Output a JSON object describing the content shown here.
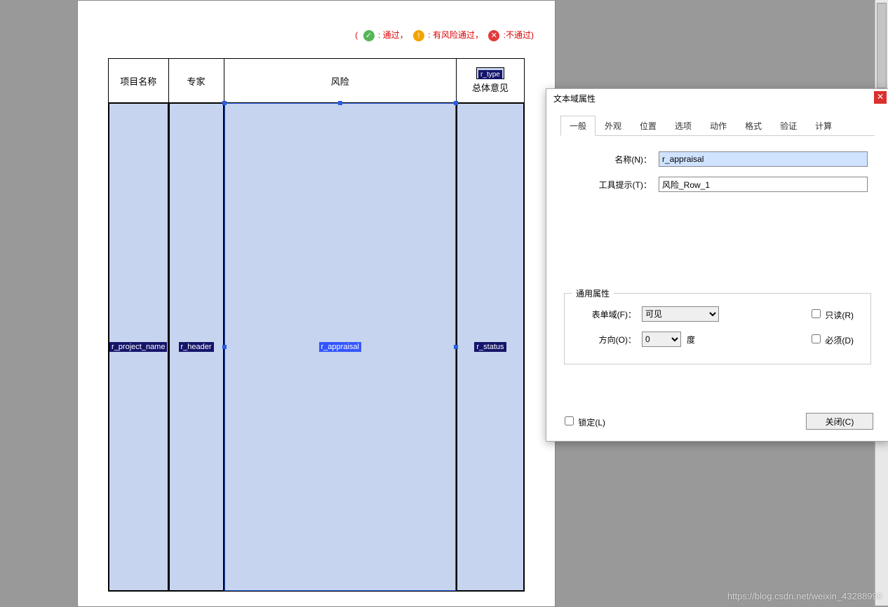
{
  "legend": {
    "open": "(",
    "pass_label": ": 通过，",
    "warn_label": ": 有风险通过，",
    "fail_label": ":不通过)",
    "pass_glyph": "✓",
    "warn_glyph": "!",
    "fail_glyph": "✕"
  },
  "table": {
    "headers": {
      "col1": "项目名称",
      "col2": "专家",
      "col3": "风险",
      "col4": "总体意见",
      "col4_field": "r_type"
    },
    "fields": {
      "col1": "r_project_name",
      "col2": "r_header",
      "col3": "r_appraisal",
      "col4": "r_status"
    }
  },
  "dialog": {
    "title": "文本域属性",
    "tabs": [
      "一般",
      "外观",
      "位置",
      "选项",
      "动作",
      "格式",
      "验证",
      "计算"
    ],
    "active_tab": 0,
    "name_label": "名称(N)：",
    "name_value": "r_appraisal",
    "tooltip_label": "工具提示(T)：",
    "tooltip_value": "风险_Row_1",
    "group_title": "通用属性",
    "formfield_label": "表单域(F)：",
    "formfield_value": "可见",
    "direction_label": "方向(O)：",
    "direction_value": "0",
    "direction_unit": "度",
    "readonly_label": "只读(R)",
    "required_label": "必须(D)",
    "lock_label": "锁定(L)",
    "close_label": "关闭(C)"
  },
  "watermark": "https://blog.csdn.net/weixin_43288999"
}
